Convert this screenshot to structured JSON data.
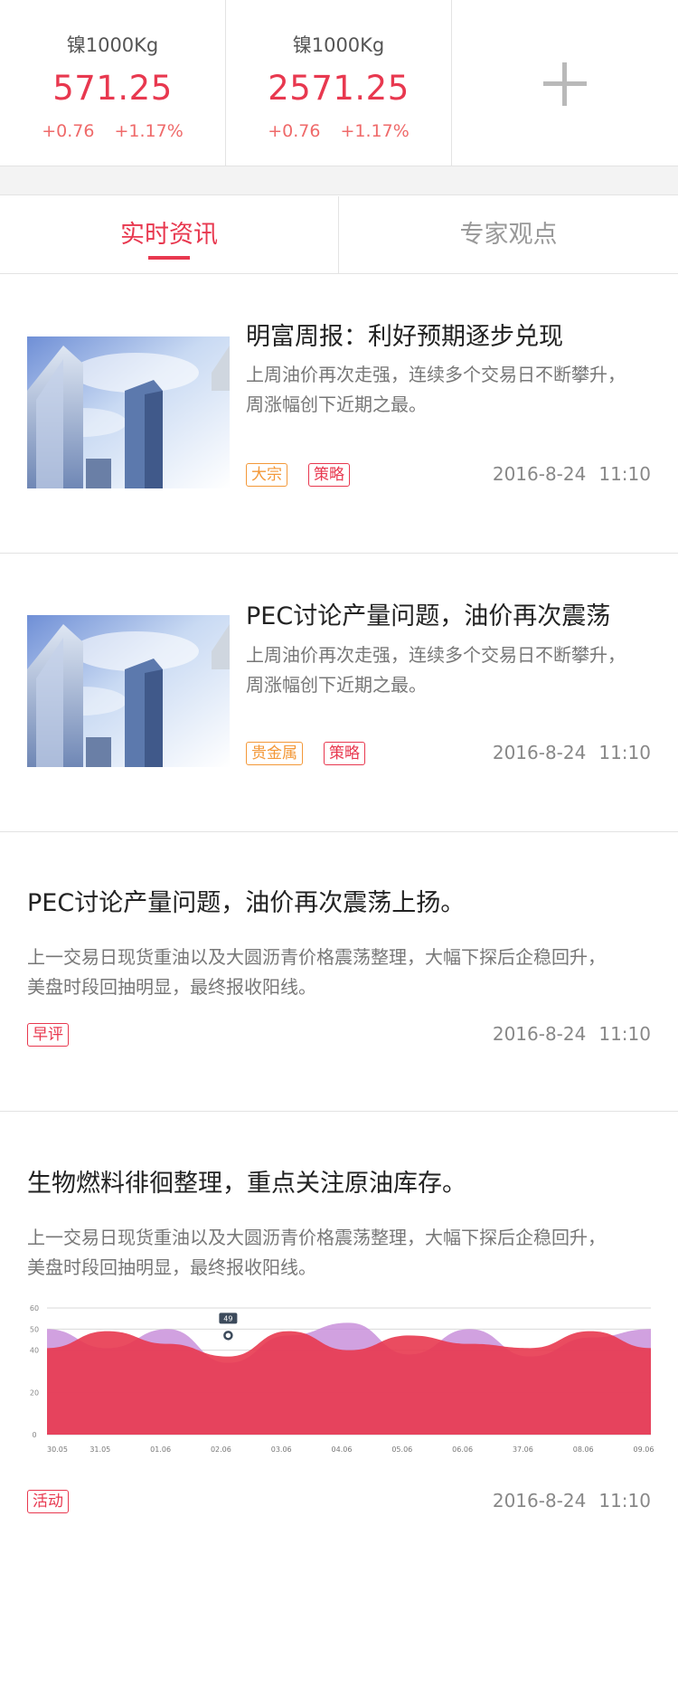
{
  "tickers": [
    {
      "name": "镍1000Kg",
      "price": "571.25",
      "change": "+0.76",
      "change_pct": "+1.17%"
    },
    {
      "name": "镍1000Kg",
      "price": "2571.25",
      "change": "+0.76",
      "change_pct": "+1.17%"
    }
  ],
  "add_icon": "plus-icon",
  "tabs": [
    {
      "label": "实时资讯",
      "active": true
    },
    {
      "label": "专家观点",
      "active": false
    }
  ],
  "articles": [
    {
      "title": "明富周报：利好预期逐步兑现",
      "summary_line1": "上周油价再次走强，连续多个交易日不断攀升，",
      "summary_line2": "周涨幅创下近期之最。",
      "tags": [
        "大宗",
        "策略"
      ],
      "date": "2016-8-24",
      "time": "11:10"
    },
    {
      "title": "PEC讨论产量问题，油价再次震荡",
      "summary_line1": "上周油价再次走强，连续多个交易日不断攀升，",
      "summary_line2": "周涨幅创下近期之最。",
      "tags": [
        "贵金属",
        "策略"
      ],
      "date": "2016-8-24",
      "time": "11:10"
    },
    {
      "title": "PEC讨论产量问题，油价再次震荡上扬。",
      "summary_line1": "上一交易日现货重油以及大圆沥青价格震荡整理，大幅下探后企稳回升，",
      "summary_line2": "美盘时段回抽明显，最终报收阳线。",
      "tags": [
        "早评"
      ],
      "date": "2016-8-24",
      "time": "11:10"
    },
    {
      "title": "生物燃料徘徊整理，重点关注原油库存。",
      "summary_line1": "上一交易日现货重油以及大圆沥青价格震荡整理，大幅下探后企稳回升，",
      "summary_line2": "美盘时段回抽明显，最终报收阳线。",
      "tags": [
        "活动"
      ],
      "date": "2016-8-24",
      "time": "11:10"
    }
  ],
  "colors": {
    "accent": "#e8384f",
    "tag_orange": "#f39838",
    "divider": "#e3e3e3",
    "area_red": "#e8384f",
    "area_purple": "#c58ad8"
  },
  "chart_data": {
    "type": "area",
    "categories": [
      "30.05",
      "31.05",
      "01.06",
      "02.06",
      "03.06",
      "04.06",
      "05.06",
      "06.06",
      "37.06",
      "08.06",
      "09.06"
    ],
    "y_ticks": [
      "0",
      "20",
      "40",
      "50",
      "60"
    ],
    "ylim": [
      0,
      60
    ],
    "grid": true,
    "tooltip": {
      "label": "49",
      "category_index": 3,
      "value": 47
    },
    "series": [
      {
        "values": [
          41,
          49,
          43,
          37,
          49,
          40,
          47,
          43,
          41,
          49,
          41
        ],
        "color": "#e8384f"
      },
      {
        "values": [
          50,
          41,
          50,
          34,
          47,
          53,
          38,
          50,
          37,
          46,
          50
        ],
        "color": "#c58ad8"
      }
    ]
  }
}
